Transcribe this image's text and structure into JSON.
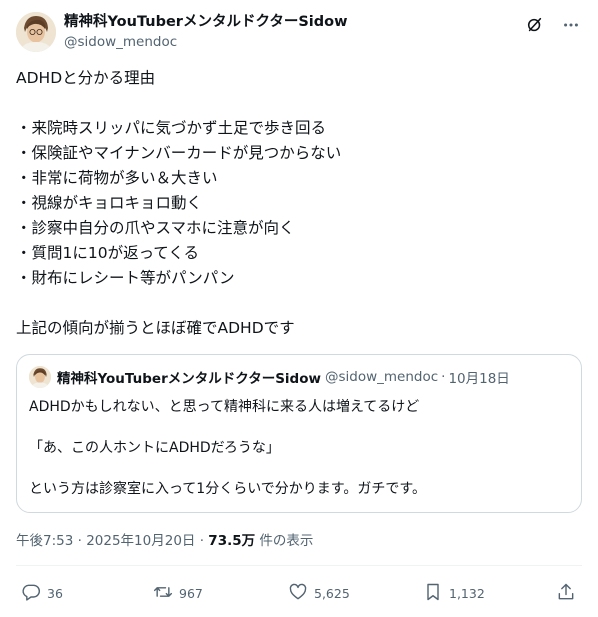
{
  "author": {
    "display_name": "精神科YouTuberメンタルドクターSidow",
    "handle": "@sidow_mendoc"
  },
  "header_icons": [
    "grok-icon",
    "more-icon"
  ],
  "tweet": {
    "lines": [
      "ADHDと分かる理由",
      "",
      "・来院時スリッパに気づかず土足で歩き回る",
      "・保険証やマイナンバーカードが見つからない",
      "・非常に荷物が多い＆大きい",
      "・視線がキョロキョロ動く",
      "・診察中自分の爪やスマホに注意が向く",
      "・質問1に10が返ってくる",
      "・財布にレシート等がパンパン",
      "",
      "上記の傾向が揃うとほぼ確でADHDです"
    ]
  },
  "quote": {
    "display_name": "精神科YouTuberメンタルドクターSidow",
    "handle": "@sidow_mendoc",
    "separator": "·",
    "date": "10月18日",
    "line1": "ADHDかもしれない、と思って精神科に来る人は増えてるけど",
    "line2": "「あ、この人ホントにADHDだろうな」",
    "line3": "という方は診察室に入って1分くらいで分かります。ガチです。"
  },
  "meta": {
    "time": "午後7:53",
    "sep1": " · ",
    "date": "2025年10月20日",
    "sep2": " · ",
    "views": "73.5万",
    "views_label": " 件の表示"
  },
  "actions": {
    "replies": "36",
    "retweets": "967",
    "likes": "5,625",
    "bookmarks": "1,132"
  }
}
